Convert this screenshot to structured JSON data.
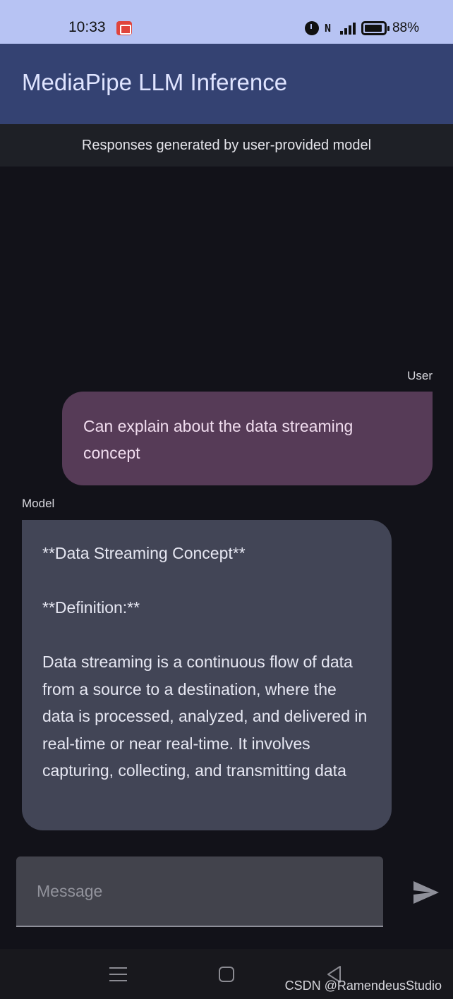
{
  "status_bar": {
    "time": "10:33",
    "battery": "88%",
    "icons": [
      "screen-record-icon",
      "alarm-icon",
      "nfc-icon",
      "signal-icon",
      "battery-icon"
    ]
  },
  "app_bar": {
    "title": "MediaPipe LLM Inference"
  },
  "subtitle": "Responses generated by user-provided model",
  "chat": {
    "user": {
      "label": "User",
      "message": "Can explain about the data streaming concept"
    },
    "model": {
      "label": "Model",
      "heading": "**Data Streaming Concept**",
      "definition": "**Definition:**",
      "body": "Data streaming is a continuous flow of data from a source to a destination, where the data is processed, analyzed, and delivered in real-time or near real-time. It involves capturing, collecting, and transmitting data"
    }
  },
  "input": {
    "placeholder": "Message",
    "value": ""
  },
  "nav_bar": {
    "icons": [
      "menu-icon",
      "home-icon",
      "back-icon"
    ]
  },
  "watermark": "CSDN @RamendeusStudio",
  "colors": {
    "status_bar": "#b7c3f3",
    "app_bar": "#344272",
    "background": "#121219",
    "user_bubble": "#563b57",
    "model_bubble": "#424556",
    "send_icon": "#8e8f99"
  }
}
